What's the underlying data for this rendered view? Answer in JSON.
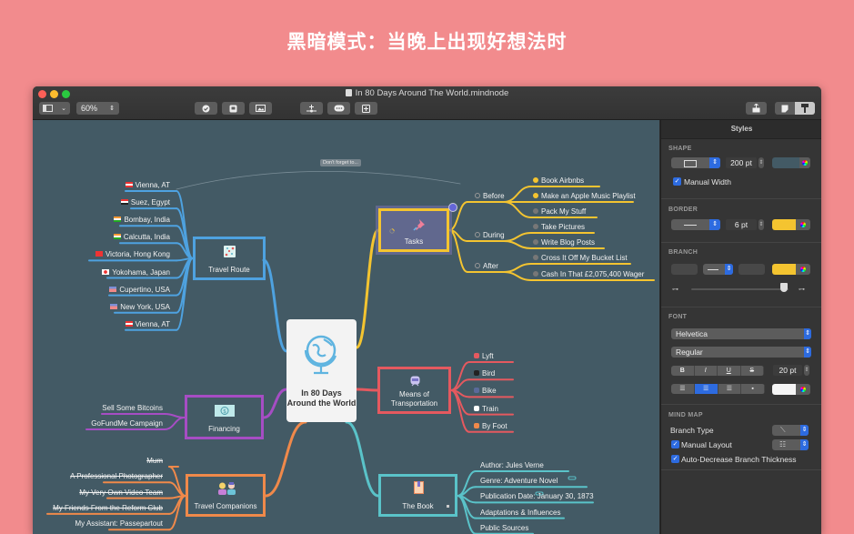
{
  "banner": {
    "text": "黑暗模式：当晚上出现好想法时"
  },
  "window": {
    "title": "In 80 Days Around The World.mindnode",
    "toolbar": {
      "zoom_value": "60%",
      "buttons": [
        "view-mode",
        "task-toggle",
        "quick-entry",
        "insert-image",
        "add-child-node",
        "add-note",
        "add-sibling-node",
        "share",
        "inspector-notes",
        "inspector-styles"
      ]
    }
  },
  "canvas": {
    "note_label": "Don't forget to...",
    "root": {
      "title": "In 80 Days Around the World",
      "icon": "globe-icon"
    },
    "branches": {
      "travel_route": {
        "title": "Travel Route",
        "color": "#4ea2e0",
        "icon": "map-route-icon",
        "items": [
          {
            "label": "Vienna, AT",
            "flag": "austria"
          },
          {
            "label": "Suez, Egypt",
            "flag": "egypt"
          },
          {
            "label": "Bombay, India",
            "flag": "india"
          },
          {
            "label": "Calcutta, India",
            "flag": "india"
          },
          {
            "label": "Victoria, Hong Kong",
            "flag": "hongkong"
          },
          {
            "label": "Yokohama, Japan",
            "flag": "japan"
          },
          {
            "label": "Cupertino, USA",
            "flag": "usa"
          },
          {
            "label": "New York, USA",
            "flag": "usa"
          },
          {
            "label": "Vienna, AT",
            "flag": "austria"
          }
        ]
      },
      "tasks": {
        "title": "Tasks",
        "color": "#f4c430",
        "icon": "pushpin-icon",
        "groups": [
          {
            "label": "Before",
            "items": [
              {
                "label": "Book Airbnbs",
                "done": true
              },
              {
                "label": "Make an Apple Music Playlist",
                "done": true
              },
              {
                "label": "Pack My Stuff",
                "done": false
              }
            ]
          },
          {
            "label": "During",
            "items": [
              {
                "label": "Take Pictures",
                "done": false
              },
              {
                "label": "Write Blog Posts",
                "done": false
              }
            ]
          },
          {
            "label": "After",
            "items": [
              {
                "label": "Cross It Off My Bucket List",
                "done": false
              },
              {
                "label": "Cash In That £2,075,400 Wager",
                "done": false
              }
            ]
          }
        ]
      },
      "financing": {
        "title": "Financing",
        "color": "#a64dc4",
        "icon": "money-icon",
        "items": [
          {
            "label": "Sell Some Bitcoins"
          },
          {
            "label": "GoFundMe Campaign"
          }
        ]
      },
      "transportation": {
        "title": "Means of Transportation",
        "color": "#e5595f",
        "icon": "train-icon",
        "items": [
          {
            "label": "Lyft",
            "icon": "car-icon"
          },
          {
            "label": "Bird",
            "icon": "scooter-icon"
          },
          {
            "label": "Bike",
            "icon": "bike-icon"
          },
          {
            "label": "Train",
            "icon": "train-icon"
          },
          {
            "label": "By Foot",
            "icon": "walking-icon"
          }
        ]
      },
      "companions": {
        "title": "Travel Companions",
        "color": "#f0894a",
        "icon": "people-icon",
        "items": [
          {
            "label": "Mum",
            "struck": true
          },
          {
            "label": "A Professional Photographer",
            "struck": true
          },
          {
            "label": "My Very Own Video Team",
            "struck": true
          },
          {
            "label": "My Friends From the Reform Club",
            "struck": true
          },
          {
            "label": "My Assistant: Passepartout",
            "struck": false
          }
        ]
      },
      "book": {
        "title": "The Book",
        "color": "#5ac3c9",
        "icon": "book-icon",
        "items": [
          {
            "label": "Author: Jules Verne"
          },
          {
            "label": "Genre: Adventure Novel"
          },
          {
            "label": "Publication Date: January 30, 1873"
          },
          {
            "label": "Adaptations & Influences"
          },
          {
            "label": "Public Sources"
          }
        ]
      }
    }
  },
  "inspector": {
    "title": "Styles",
    "shape": {
      "heading": "SHAPE",
      "width": "200 pt",
      "manual_width_label": "Manual Width",
      "manual_width": true,
      "fill_color": "#435a65"
    },
    "border": {
      "heading": "BORDER",
      "width": "6 pt",
      "color": "#f4c430"
    },
    "branch": {
      "heading": "BRANCH",
      "color": "#f4c430",
      "thickness_fraction": 0.95
    },
    "font": {
      "heading": "FONT",
      "family": "Helvetica",
      "style": "Regular",
      "size": "20 pt",
      "style_buttons": [
        "B",
        "I",
        "U",
        "S"
      ],
      "alignment": "center",
      "color": "#f5f5f5"
    },
    "mind_map": {
      "heading": "MIND MAP",
      "branch_type_label": "Branch Type",
      "manual_layout_label": "Manual Layout",
      "manual_layout": true,
      "auto_decrease_label": "Auto-Decrease Branch Thickness",
      "auto_decrease": true
    }
  }
}
